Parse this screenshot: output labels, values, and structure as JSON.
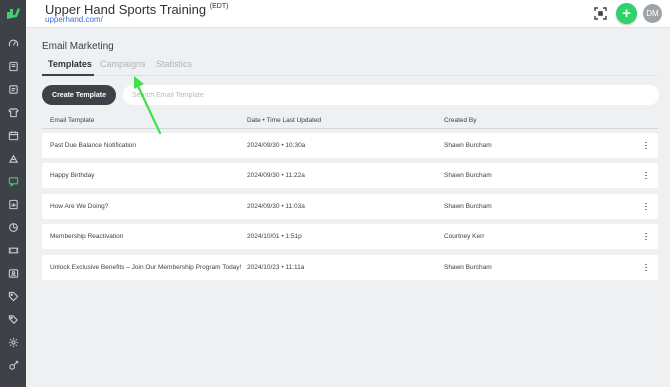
{
  "header": {
    "title": "Upper Hand Sports Training",
    "timezone": "(EDT)",
    "url": "upperhand.com/",
    "avatar_initials": "DM",
    "plus_label": "+"
  },
  "sidebar": {
    "items": [
      {
        "icon": "dashboard-icon"
      },
      {
        "icon": "book-icon"
      },
      {
        "icon": "notebook-icon"
      },
      {
        "icon": "jersey-icon"
      },
      {
        "icon": "calendar-icon"
      },
      {
        "icon": "team-icon"
      },
      {
        "icon": "message-icon",
        "active": true
      },
      {
        "icon": "report-icon"
      },
      {
        "icon": "chart-pie-icon"
      },
      {
        "icon": "ticket-icon"
      },
      {
        "icon": "id-card-icon"
      },
      {
        "icon": "tag-icon"
      },
      {
        "icon": "tags-icon"
      },
      {
        "icon": "settings-icon"
      },
      {
        "icon": "tools-icon"
      }
    ]
  },
  "page": {
    "title": "Email Marketing",
    "tabs": [
      {
        "label": "Templates",
        "active": true
      },
      {
        "label": "Campaigns",
        "active": false
      },
      {
        "label": "Statistics",
        "active": false
      }
    ],
    "create_button": "Create Template",
    "search_placeholder": "Search Email Template"
  },
  "table": {
    "columns": [
      "Email Template",
      "Date • Time Last Updated",
      "Created By"
    ],
    "rows": [
      {
        "name": "Past Due Balance Notification",
        "updated": "2024/09/30 • 10:30a",
        "created_by": "Shawn Burcham"
      },
      {
        "name": "Happy Birthday",
        "updated": "2024/09/30 • 11:22a",
        "created_by": "Shawn Burcham"
      },
      {
        "name": "How Are We Doing?",
        "updated": "2024/09/30 • 11:03a",
        "created_by": "Shawn Burcham"
      },
      {
        "name": "Membership Reactivation",
        "updated": "2024/10/01 • 1:51p",
        "created_by": "Courtney Kerr"
      },
      {
        "name": "Unlock Exclusive Benefits – Join Our Membership Program Today!",
        "updated": "2024/10/23 • 11:11a",
        "created_by": "Shawn Burcham"
      }
    ]
  },
  "colors": {
    "sidebar": "#3d4148",
    "accent_green": "#2fd36b",
    "link_blue": "#3a6fd8",
    "annotation_arrow": "#3fe04a"
  }
}
